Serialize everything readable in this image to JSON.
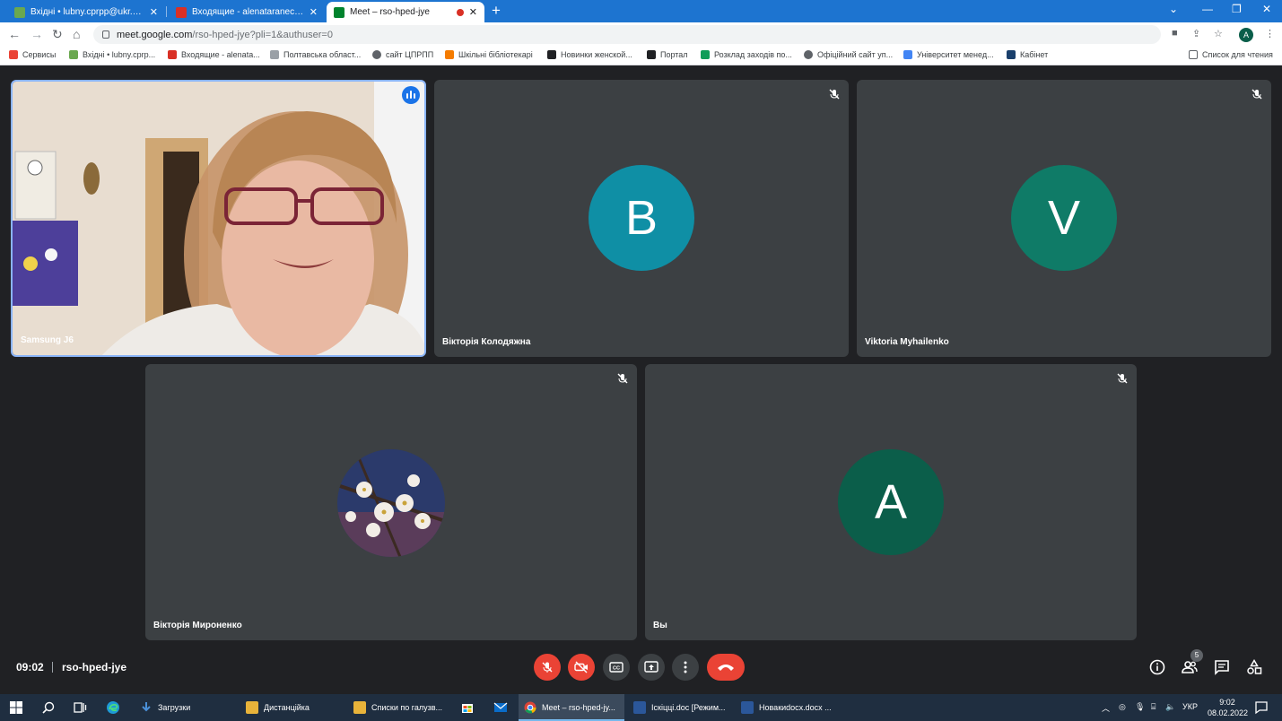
{
  "browser": {
    "tabs": [
      {
        "title": "Вхідні • lubny.cprpp@ukr.net",
        "icon": "ukrnet-icon",
        "active": false
      },
      {
        "title": "Входящие - alenataranec2019@",
        "icon": "gmail-icon",
        "active": false
      },
      {
        "title": "Meet – rso-hped-jye",
        "icon": "meet-icon",
        "active": true
      }
    ],
    "new_tab": "+",
    "url_host": "meet.google.com",
    "url_path": "/rso-hped-jye?pli=1&authuser=0",
    "profile_initial": "A",
    "bookmarks": [
      {
        "label": "Сервисы",
        "color": "#ea4335"
      },
      {
        "label": "Вхідні • lubny.cprp...",
        "color": "#6aa84f"
      },
      {
        "label": "Входящие - alenata...",
        "color": "#d93025"
      },
      {
        "label": "Полтавська област...",
        "color": "#9aa0a6"
      },
      {
        "label": "сайт ЦПРПП",
        "color": "#5f6368"
      },
      {
        "label": "Шкільні бібліотекарі",
        "color": "#f57c00"
      },
      {
        "label": "Новинки женской...",
        "color": "#202124"
      },
      {
        "label": "Портал",
        "color": "#202124"
      },
      {
        "label": "Розклад заходів по...",
        "color": "#0f9d58"
      },
      {
        "label": "Офіційний сайт уп...",
        "color": "#5f6368"
      },
      {
        "label": "Університет менед...",
        "color": "#4285f4"
      },
      {
        "label": "Кабінет",
        "color": "#1a3f6b"
      }
    ],
    "reading_list": "Список для чтения"
  },
  "meet": {
    "participants": [
      {
        "name": "Samsung J6",
        "type": "video",
        "speaking": true
      },
      {
        "name": "Вікторія Колодяжна",
        "initial": "B",
        "color": "#0f8fa5",
        "muted": true
      },
      {
        "name": "Viktoria Myhailenko",
        "initial": "V",
        "color": "#0f7b67",
        "muted": true
      },
      {
        "name": "Вікторія Мироненко",
        "type": "photo",
        "muted": true
      },
      {
        "name": "Вы",
        "initial": "A",
        "color": "#0b5e4a",
        "muted": true
      }
    ],
    "time": "09:02",
    "meeting_code": "rso-hped-jye",
    "participant_count": "5",
    "colors": {
      "accent_red": "#ea4335",
      "bg": "#202124",
      "tile": "#3c4043"
    }
  },
  "taskbar": {
    "apps": [
      {
        "label": "Загрузки",
        "color": "#4a90d9"
      },
      {
        "label": "Дистанційка",
        "color": "#e8b33a"
      },
      {
        "label": "Списки по галузв...",
        "color": "#e8b33a"
      },
      {
        "label": "Meet – rso-hped-jy...",
        "color": "#4285f4",
        "active": true
      },
      {
        "label": "Іскіцці.doc [Режим...",
        "color": "#2b579a"
      },
      {
        "label": "Новакиdocx.docx ...",
        "color": "#2b579a"
      }
    ],
    "lang": "УКР",
    "time": "9:02",
    "date": "08.02.2022"
  }
}
